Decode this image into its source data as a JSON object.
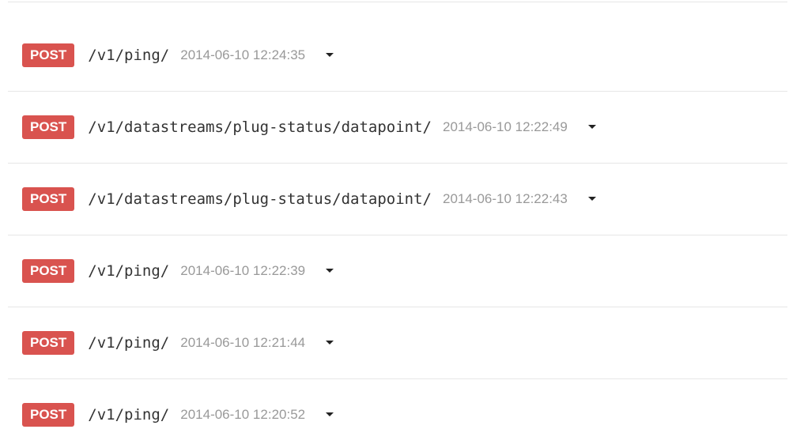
{
  "requests": [
    {
      "method": "POST",
      "path": "/v1/ping/",
      "timestamp": "2014-06-10 12:24:35"
    },
    {
      "method": "POST",
      "path": "/v1/datastreams/plug-status/datapoint/",
      "timestamp": "2014-06-10 12:22:49"
    },
    {
      "method": "POST",
      "path": "/v1/datastreams/plug-status/datapoint/",
      "timestamp": "2014-06-10 12:22:43"
    },
    {
      "method": "POST",
      "path": "/v1/ping/",
      "timestamp": "2014-06-10 12:22:39"
    },
    {
      "method": "POST",
      "path": "/v1/ping/",
      "timestamp": "2014-06-10 12:21:44"
    },
    {
      "method": "POST",
      "path": "/v1/ping/",
      "timestamp": "2014-06-10 12:20:52"
    }
  ],
  "colors": {
    "badge": "#d9534f",
    "path": "#333333",
    "timestamp": "#999999",
    "divider": "#e6e6e6"
  },
  "icons": {
    "expand": "caret-down-icon"
  }
}
